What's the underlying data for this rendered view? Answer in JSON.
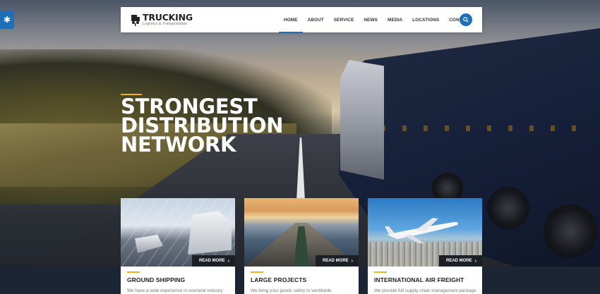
{
  "header": {
    "brand_title": "TRUCKING",
    "brand_subtitle": "Logistics & Transportation",
    "nav": [
      {
        "label": "HOME",
        "active": true
      },
      {
        "label": "ABOUT",
        "active": false
      },
      {
        "label": "SERVICE",
        "active": false
      },
      {
        "label": "NEWS",
        "active": false
      },
      {
        "label": "MEDIA",
        "active": false
      },
      {
        "label": "LOCATIONS",
        "active": false
      },
      {
        "label": "CONTACT",
        "active": false
      }
    ],
    "search_icon": "search-icon"
  },
  "side_tab_icon": "gear-icon",
  "hero": {
    "line1": "STRONGEST",
    "line2": "DISTRIBUTION",
    "line3": "NETWORK"
  },
  "cards": [
    {
      "title": "GROUND SHIPPING",
      "text": "We have a wide experience in overland industry",
      "button": "READ MORE"
    },
    {
      "title": "LARGE PROJECTS",
      "text": "We bring your goods safely to worldwide",
      "button": "READ MORE"
    },
    {
      "title": "INTERNATIONAL AIR FREIGHT",
      "text": "We provide full supply chain management package",
      "button": "READ MORE"
    }
  ],
  "colors": {
    "accent_blue": "#1e6fb8",
    "accent_yellow": "#f3b21c",
    "dark_band": "#1c2534"
  }
}
